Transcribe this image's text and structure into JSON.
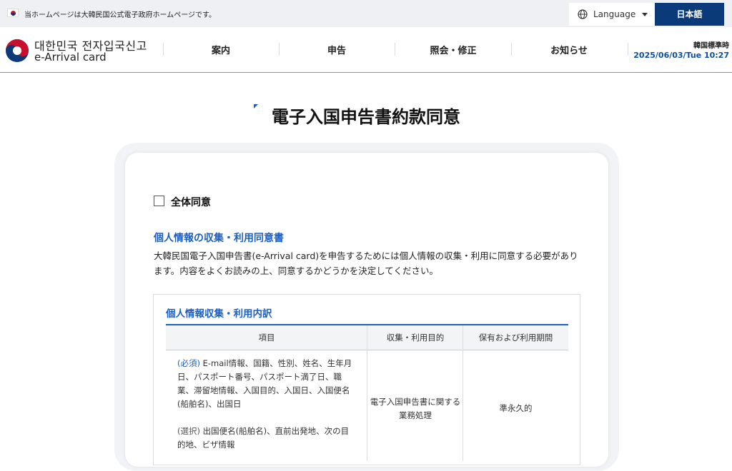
{
  "gov_bar": {
    "notice": "当ホームページは大韓民国公式電子政府ホームページです。",
    "language_label": "Language",
    "language_selected": "日本語"
  },
  "header": {
    "logo_korean": "대한민국 전자입국신고",
    "logo_english": "e-Arrival card",
    "nav": [
      "案内",
      "申告",
      "照会・修正",
      "お知らせ"
    ],
    "timezone_label": "韓国標準時",
    "datetime": "2025/06/03/Tue 10:27"
  },
  "page": {
    "title": "電子入国申告書約款同意"
  },
  "consent": {
    "agree_all_label": "全体同意",
    "section_heading": "個人情報の収集・利用同意書",
    "section_desc": "大韓民国電子入国申告書(e-Arrival card)を申告するためには個人情報の収集・利用に同意する必要があります。内容をよくお読みの上、同意するかどうかを決定してください。",
    "breakdown_heading": "個人情報収集・利用内訳",
    "table": {
      "headers": [
        "項目",
        "収集・利用目的",
        "保有および利用期間"
      ],
      "required_tag": "(必須)",
      "required_items": "E-mail情報、国籍、性別、姓名、生年月日、パスポート番号、パスポート満了日、職業、滞留地情報、入国目的、入国日、入国便名(船舶名)、出国日",
      "optional_tag": "(選択)",
      "optional_items": "出国便名(船舶名)、直前出発地、次の目的地、ビザ情報",
      "purpose": "電子入国申告書に関する業務処理",
      "period": "準永久的"
    }
  },
  "colors": {
    "brand_navy": "#0b3a7a",
    "accent_blue": "#1a5fc7",
    "time_blue": "#0b4ea2"
  }
}
